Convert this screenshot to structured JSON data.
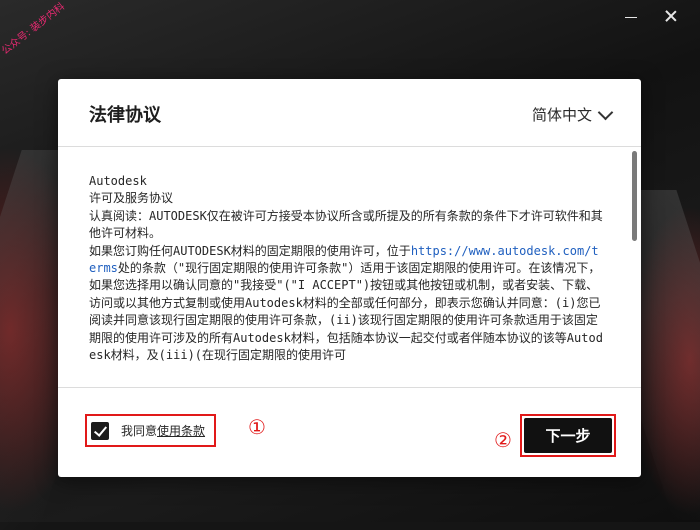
{
  "watermark": "公众号: 装步内科",
  "window": {
    "minimize_icon": "minimize-icon",
    "close_icon": "close-icon"
  },
  "dialog": {
    "title": "法律协议",
    "language": "简体中文"
  },
  "agreement": {
    "line_brand": "Autodesk",
    "line_title": "许可及服务协议",
    "para_1": "认真阅读：AUTODESK仅在被许可方接受本协议所含或所提及的所有条款的条件下才许可软件和其他许可材料。",
    "para_2_pre": "如果您订购任何AUTODESK材料的固定期限的使用许可，位于",
    "para_2_link": "https://www.autodesk.com/terms",
    "para_2_post": "处的条款（\"现行固定期限的使用许可条款\"）适用于该固定期限的使用许可。在该情况下，如果您选择用以确认同意的\"我接受\"(\"I ACCEPT\")按钮或其他按钮或机制，或者安装、下载、访问或以其他方式复制或使用Autodesk材料的全部或任何部分，即表示您确认并同意：(i)您已阅读并同意该现行固定期限的使用许可条款，(ii)该现行固定期限的使用许可条款适用于该固定期限的使用许可涉及的所有Autodesk材料，包括随本协议一起交付或者伴随本协议的该等Autodesk材料，及(iii)(在现行固定期限的使用许可"
  },
  "footer": {
    "agree_prefix": "我同意",
    "terms_link": "使用条款",
    "agree_checked": true,
    "marker_1": "①",
    "marker_2": "②",
    "next_label": "下一步"
  },
  "colors": {
    "accent_annotation": "#e11919",
    "button_bg": "#111111",
    "link": "#1f5fbf"
  }
}
